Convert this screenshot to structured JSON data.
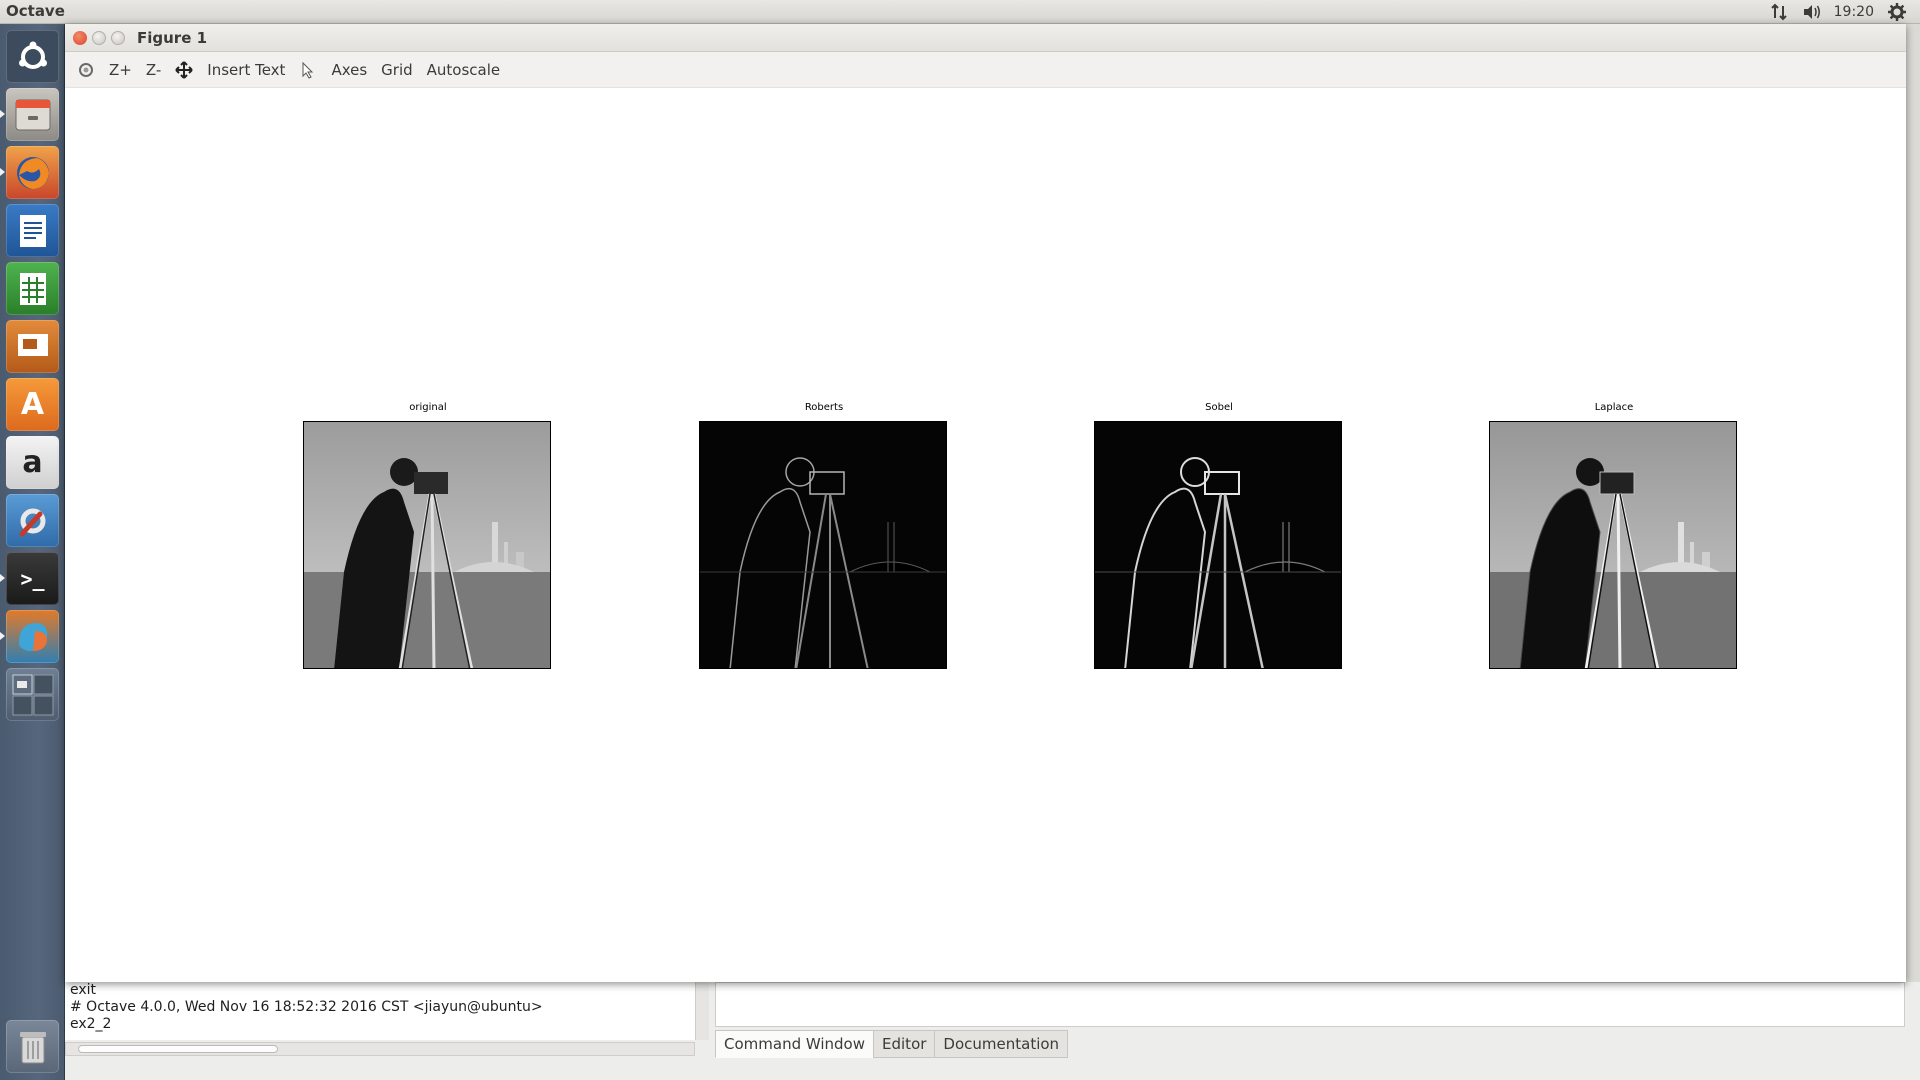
{
  "top_panel": {
    "app_title": "Octave",
    "clock": "19:20",
    "icons": [
      "network-icon",
      "volume-icon",
      "settings-gear-icon"
    ]
  },
  "launcher": {
    "items": [
      {
        "name": "dash-home",
        "icon": "ubuntu-logo-icon"
      },
      {
        "name": "files",
        "icon": "file-cabinet-icon"
      },
      {
        "name": "firefox",
        "icon": "firefox-icon"
      },
      {
        "name": "libreoffice-writer",
        "icon": "writer-document-icon"
      },
      {
        "name": "libreoffice-calc",
        "icon": "calc-spreadsheet-icon"
      },
      {
        "name": "libreoffice-impress",
        "icon": "impress-presentation-icon"
      },
      {
        "name": "ubuntu-software-center",
        "icon": "software-center-bag-icon",
        "glyph": "A"
      },
      {
        "name": "amazon",
        "icon": "amazon-icon",
        "glyph": "a"
      },
      {
        "name": "system-settings",
        "icon": "wrench-gear-icon"
      },
      {
        "name": "terminal",
        "icon": "terminal-icon",
        "glyph": ">_"
      },
      {
        "name": "octave",
        "icon": "octave-icon"
      },
      {
        "name": "workspace-switcher",
        "icon": "workspace-switcher-icon"
      },
      {
        "name": "trash",
        "icon": "trash-icon"
      }
    ]
  },
  "figure_window": {
    "title": "Figure 1",
    "toolbar": {
      "rotate_icon": "rotate-icon",
      "zoom_in": "Z+",
      "zoom_out": "Z-",
      "pan_icon": "pan-move-icon",
      "insert_text": "Insert Text",
      "select_icon": "pointer-arrow-icon",
      "axes": "Axes",
      "grid": "Grid",
      "autoscale": "Autoscale"
    },
    "subplots": [
      {
        "title": "original",
        "image": "cameraman-grayscale"
      },
      {
        "title": "Roberts",
        "image": "cameraman-roberts-edges"
      },
      {
        "title": "Sobel",
        "image": "cameraman-sobel-edges"
      },
      {
        "title": "Laplace",
        "image": "cameraman-laplace-sharpened"
      }
    ]
  },
  "octave_main": {
    "command_output": [
      "exit",
      "# Octave 4.0.0, Wed Nov 16 18:52:32 2016 CST <jiayun@ubuntu>",
      "ex2_2"
    ],
    "tabs": [
      {
        "label": "Command Window",
        "active": true
      },
      {
        "label": "Editor",
        "active": false
      },
      {
        "label": "Documentation",
        "active": false
      }
    ]
  },
  "colors": {
    "launcher_bg": "#52627a",
    "close_button": "#e8563a",
    "panel_bg": "#dfdbd2"
  }
}
